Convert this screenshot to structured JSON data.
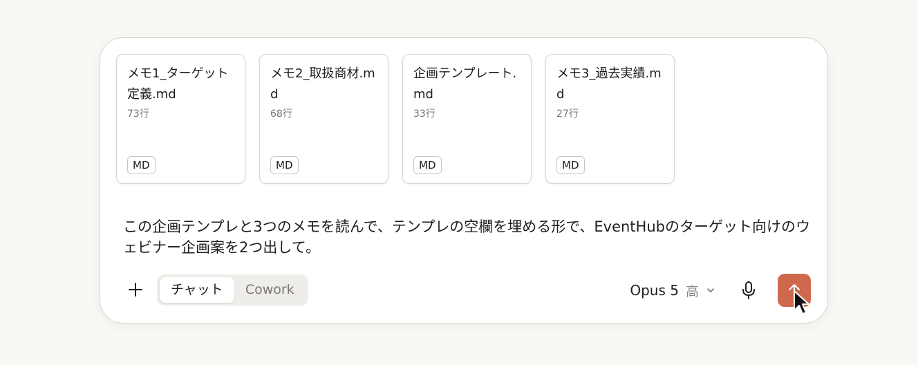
{
  "attachments": [
    {
      "title": "メモ1_ターゲット定義.md",
      "lines": "73行",
      "type": "MD"
    },
    {
      "title": "メモ2_取扱商材.md",
      "lines": "68行",
      "type": "MD"
    },
    {
      "title": "企画テンプレート.md",
      "lines": "33行",
      "type": "MD"
    },
    {
      "title": "メモ3_過去実績.md",
      "lines": "27行",
      "type": "MD"
    }
  ],
  "prompt": {
    "text": "この企画テンプレと3つのメモを読んで、テンプレの空欄を埋める形で、EventHubのターゲット向けのウェビナー企画案を2つ出して。"
  },
  "toolbar": {
    "add_icon": "plus-icon",
    "mode_options": [
      "チャット",
      "Cowork"
    ],
    "mode_selected": "チャット",
    "model_name": "Opus 5",
    "effort_level": "高",
    "mic_icon": "microphone-icon",
    "send_icon": "arrow-up-icon"
  },
  "colors": {
    "background": "#f9f8f4",
    "send_button": "#cf694d",
    "border": "#d6d4cf"
  }
}
